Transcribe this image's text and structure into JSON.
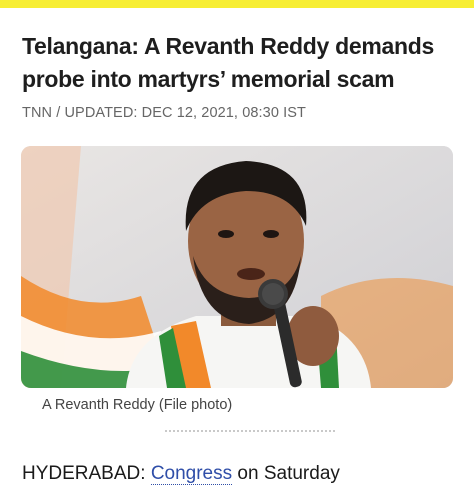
{
  "article": {
    "headline": "Telangana: A Revanth Reddy demands probe into martyrs’ memorial scam",
    "byline": "TNN / UPDATED: DEC 12, 2021, 08:30 IST",
    "image_caption": "A Revanth Reddy (File photo)",
    "lede": {
      "city": "HYDERABAD:",
      "link_text": "Congress",
      "rest": "on Saturday"
    }
  },
  "colors": {
    "top_accent": "#f7ee34",
    "link": "#2f4ea8",
    "saffron": "#f2892a",
    "flag_green": "#2f8f3a"
  }
}
